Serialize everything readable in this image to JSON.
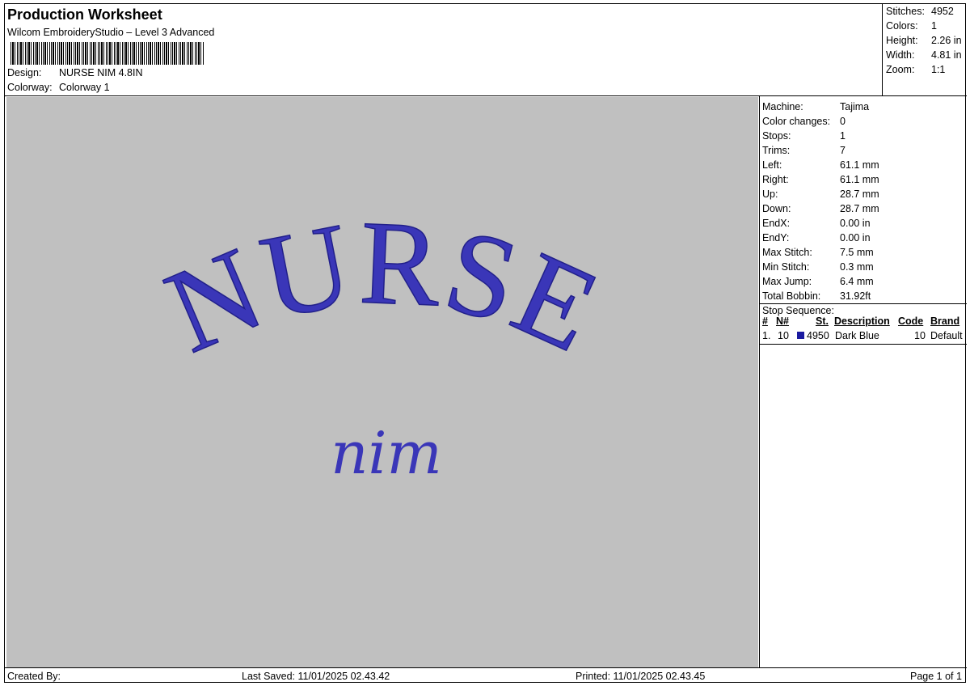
{
  "header": {
    "title": "Production Worksheet",
    "subtitle": "Wilcom EmbroideryStudio – Level 3 Advanced",
    "design_label": "Design:",
    "design_value": "NURSE NIM 4.8IN",
    "colorway_label": "Colorway:",
    "colorway_value": "Colorway 1"
  },
  "summary": [
    {
      "label": "Stitches:",
      "value": "4952"
    },
    {
      "label": "Colors:",
      "value": "1"
    },
    {
      "label": "Height:",
      "value": "2.26 in"
    },
    {
      "label": "Width:",
      "value": "4.81 in"
    },
    {
      "label": "Zoom:",
      "value": "1:1"
    }
  ],
  "details": [
    {
      "label": "Machine:",
      "value": "Tajima"
    },
    {
      "label": "Color changes:",
      "value": "0"
    },
    {
      "label": "Stops:",
      "value": "1"
    },
    {
      "label": "Trims:",
      "value": "7"
    },
    {
      "label": "Left:",
      "value": "61.1 mm"
    },
    {
      "label": "Right:",
      "value": "61.1 mm"
    },
    {
      "label": "Up:",
      "value": "28.7 mm"
    },
    {
      "label": "Down:",
      "value": "28.7 mm"
    },
    {
      "label": "EndX:",
      "value": "0.00 in"
    },
    {
      "label": "EndY:",
      "value": "0.00 in"
    },
    {
      "label": "Max Stitch:",
      "value": "7.5 mm"
    },
    {
      "label": "Min Stitch:",
      "value": "0.3 mm"
    },
    {
      "label": "Max Jump:",
      "value": "6.4 mm"
    },
    {
      "label": "Total Bobbin:",
      "value": "31.92ft"
    }
  ],
  "stop_sequence": {
    "title": "Stop Sequence:",
    "headers": {
      "num": "#",
      "n": "N#",
      "st": "St.",
      "description": "Description",
      "code": "Code",
      "brand": "Brand"
    },
    "rows": [
      {
        "num": "1.",
        "n": "10",
        "st": "4950",
        "description": "Dark Blue",
        "code": "10",
        "brand": "Default",
        "color": "#1a1aa0"
      }
    ]
  },
  "design_art": {
    "main_text": "NURSE",
    "script_text": "nim",
    "thread_color": "#3a36b8"
  },
  "footer": {
    "created_by": "Created By:",
    "last_saved": "Last Saved: 11/01/2025 02.43.42",
    "printed": "Printed: 11/01/2025 02.43.45",
    "page": "Page 1 of 1"
  }
}
